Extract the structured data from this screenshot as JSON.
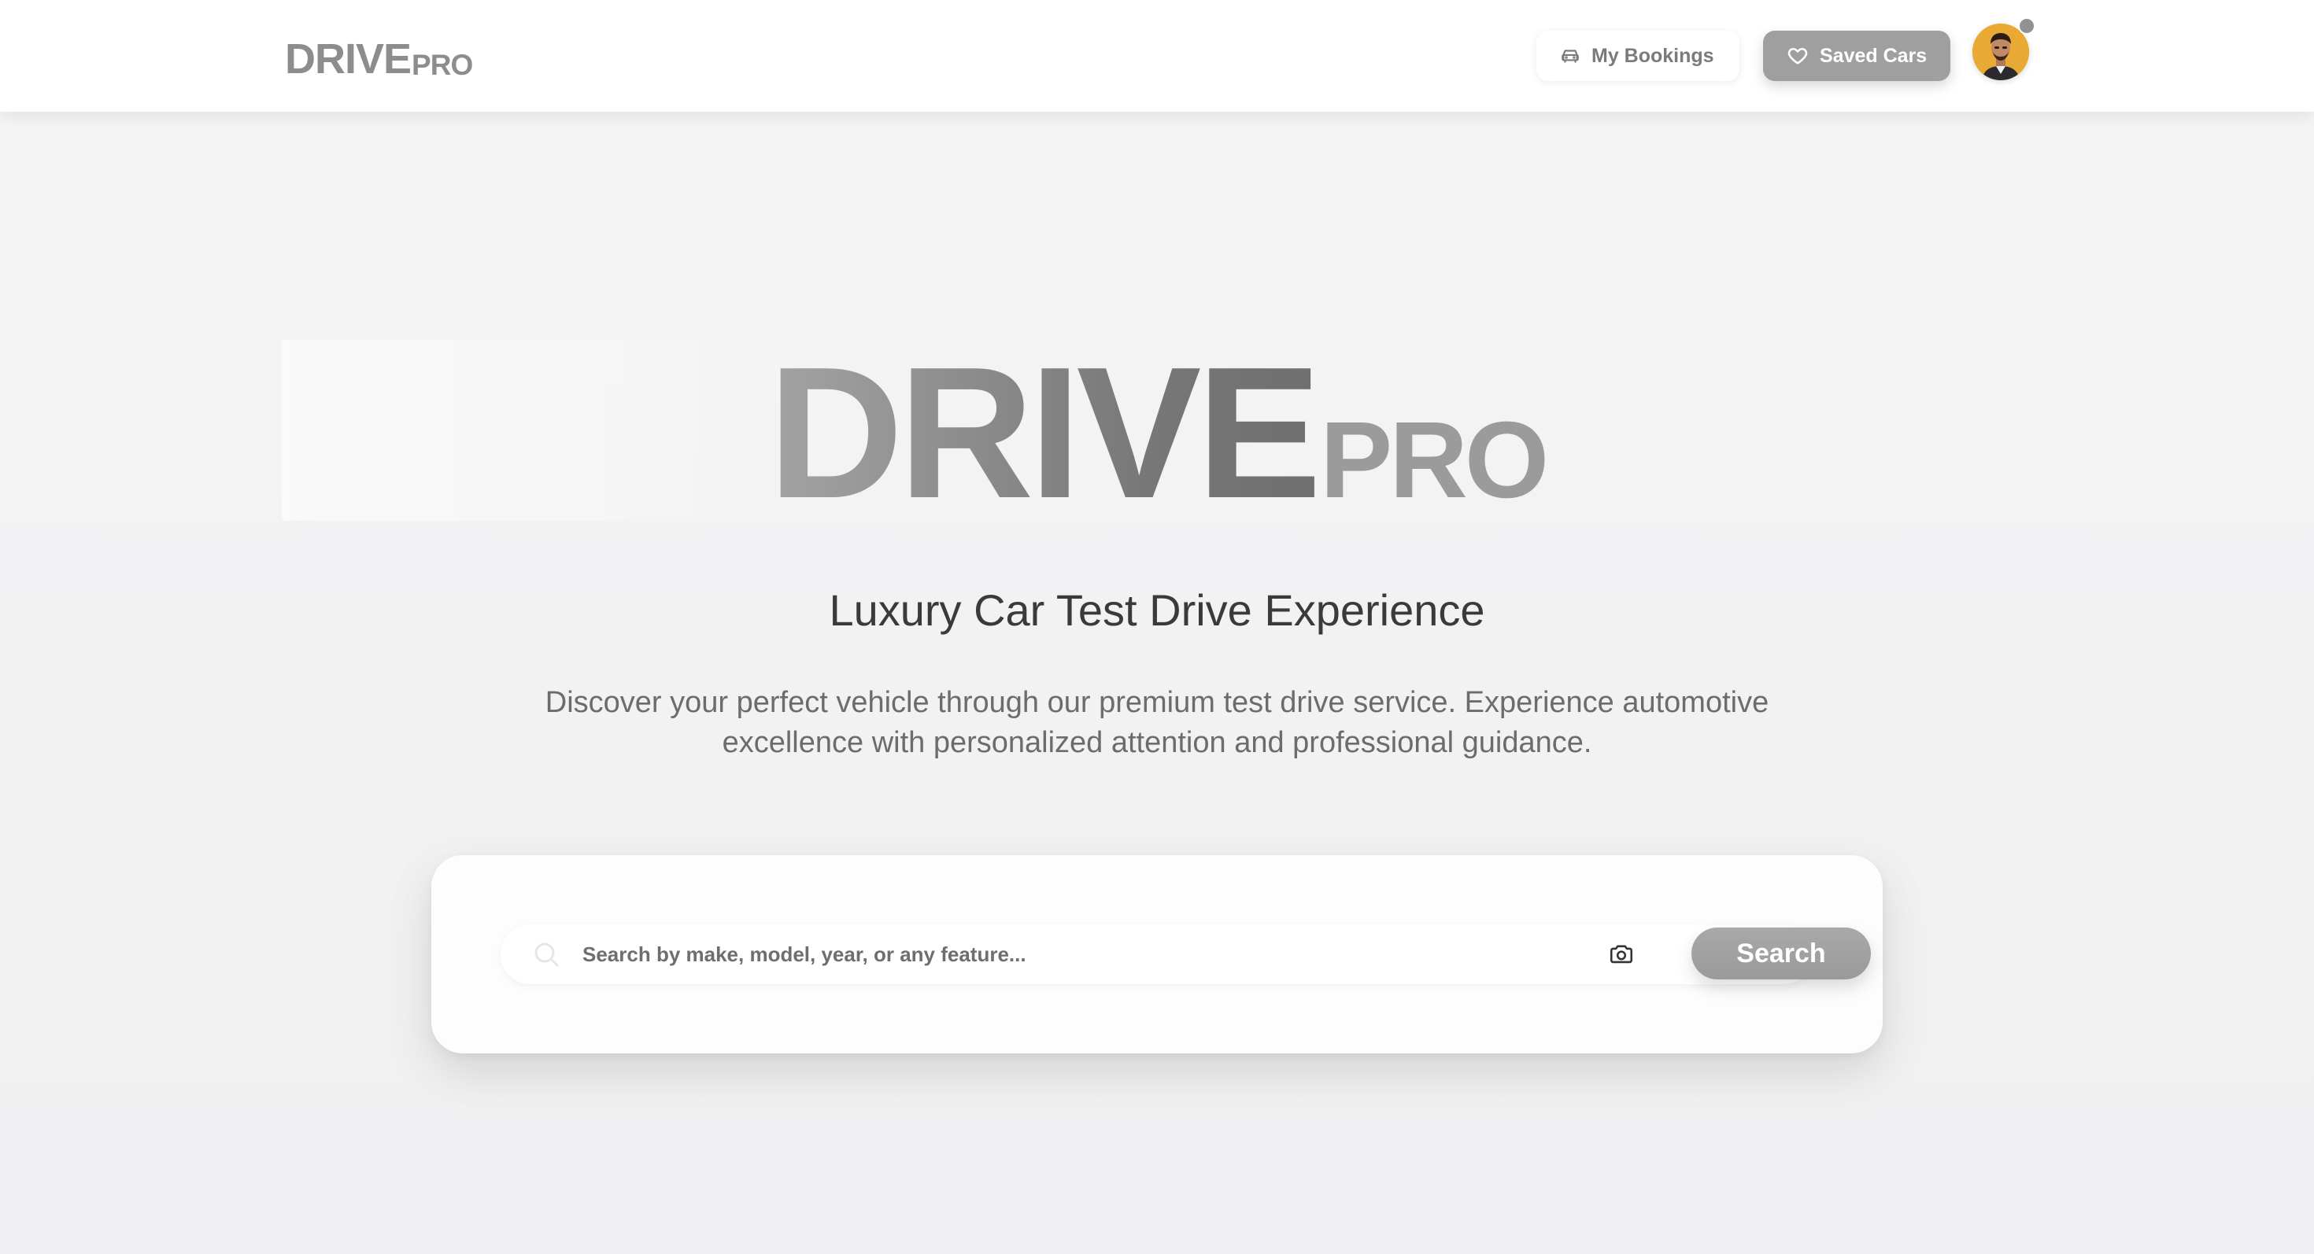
{
  "header": {
    "brand": {
      "main": "DRIVE",
      "suffix": "PRO"
    },
    "nav": {
      "bookings_label": "My Bookings",
      "bookings_icon": "car-icon",
      "saved_label": "Saved Cars",
      "saved_icon": "heart-icon"
    },
    "user": {
      "avatar_icon": "user-avatar",
      "status_color": "#929292"
    }
  },
  "hero": {
    "logo": {
      "main": "DRIVE",
      "suffix": "PRO"
    },
    "tagline": "Luxury Car Test Drive Experience",
    "description": "Discover your perfect vehicle through our premium test drive service. Experience automotive excellence with personalized attention and professional guidance."
  },
  "search": {
    "placeholder": "Search by make, model, year, or any feature...",
    "value": "",
    "camera_icon": "camera-icon",
    "button_label": "Search"
  },
  "colors": {
    "accent_gray": "#9f9f9f",
    "avatar_bg": "#e8a935",
    "background": "#f3f3f4"
  }
}
